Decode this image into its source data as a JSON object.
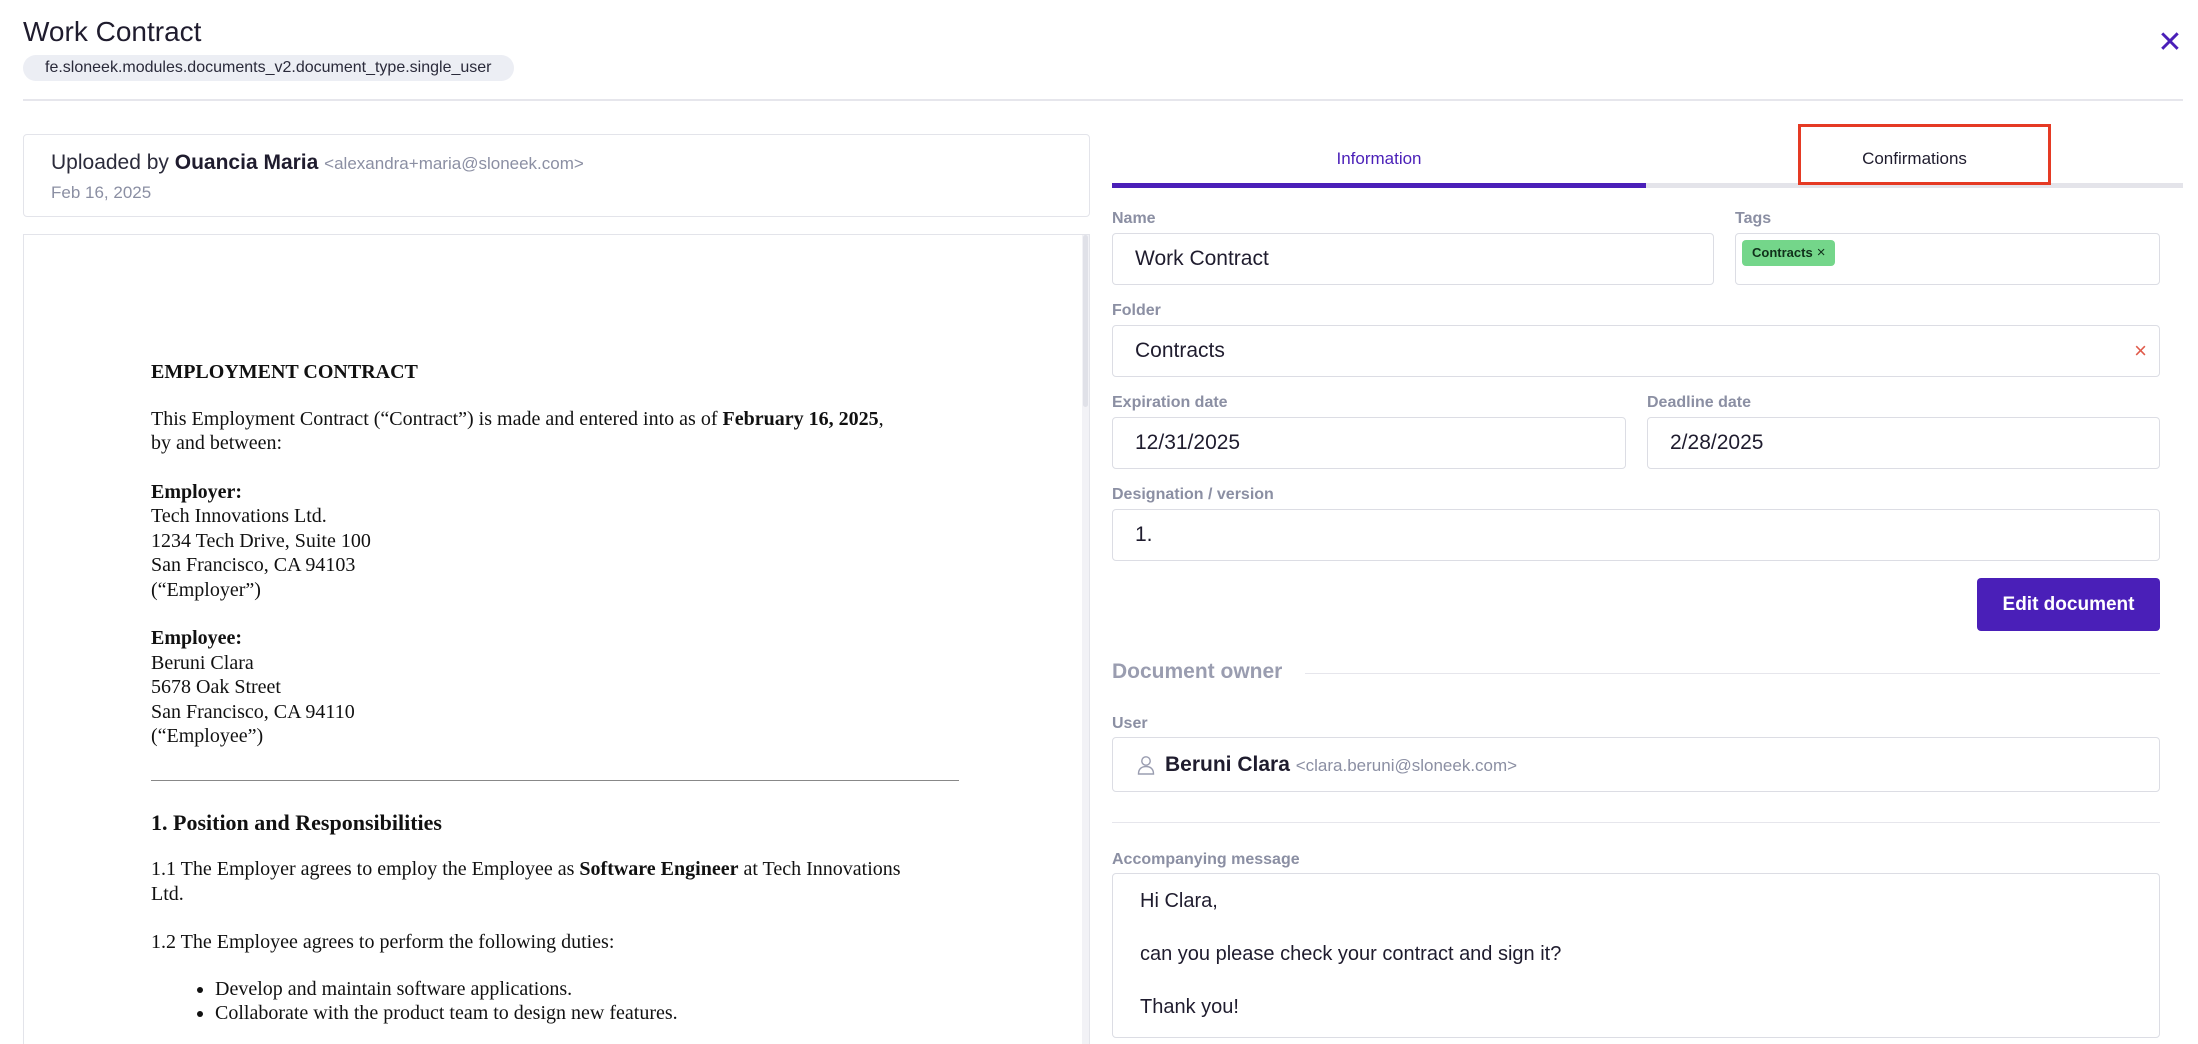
{
  "header": {
    "title": "Work Contract",
    "doc_type": "fe.sloneek.modules.documents_v2.document_type.single_user",
    "close_icon": "close-icon"
  },
  "upload": {
    "prefix": "Uploaded by",
    "name": "Ouancia Maria",
    "email": "<alexandra+maria@sloneek.com>",
    "date": "Feb 16, 2025"
  },
  "document": {
    "heading": "EMPLOYMENT CONTRACT",
    "intro_a": "This Employment Contract (“Contract”) is made and entered into as of ",
    "intro_date": "February 16, 2025",
    "intro_b": ",",
    "intro_c": "by and between:",
    "employer_label": "Employer:",
    "employer_lines": [
      "Tech Innovations Ltd.",
      "1234 Tech Drive, Suite 100",
      "San Francisco, CA 94103",
      "(“Employer”)"
    ],
    "employee_label": "Employee:",
    "employee_lines": [
      "Beruni Clara",
      "5678 Oak Street",
      "San Francisco, CA 94110",
      "(“Employee”)"
    ],
    "section1_title": "1. Position and Responsibilities",
    "clause_1_1_a": "1.1 The Employer agrees to employ the Employee as ",
    "clause_1_1_role": "Software Engineer",
    "clause_1_1_b": " at Tech Innovations",
    "clause_1_1_c": "Ltd.",
    "clause_1_2": "1.2 The Employee agrees to perform the following duties:",
    "duties": [
      "Develop and maintain software applications.",
      "Collaborate with the product team to design new features."
    ]
  },
  "tabs": {
    "information": "Information",
    "confirmations": "Confirmations",
    "active": "information"
  },
  "form": {
    "name_label": "Name",
    "name_value": "Work Contract",
    "tags_label": "Tags",
    "tag_value": "Contracts",
    "tag_remove": "×",
    "folder_label": "Folder",
    "folder_value": "Contracts",
    "folder_clear": "×",
    "expiration_label": "Expiration date",
    "expiration_value": "12/31/2025",
    "deadline_label": "Deadline date",
    "deadline_value": "2/28/2025",
    "version_label": "Designation / version",
    "version_value": "1.",
    "edit_button": "Edit document"
  },
  "owner": {
    "section_title": "Document owner",
    "user_label": "User",
    "user_name": "Beruni Clara",
    "user_email": "<clara.beruni@sloneek.com>",
    "user_icon": "user-icon"
  },
  "message": {
    "label": "Accompanying message",
    "lines": [
      "Hi Clara,",
      "can you please check your contract and sign it?",
      "Thank you!"
    ]
  },
  "colors": {
    "accent": "#4a1fb8",
    "highlight": "#e53a24",
    "tag": "#74d68a",
    "muted": "#8b8fa3"
  }
}
